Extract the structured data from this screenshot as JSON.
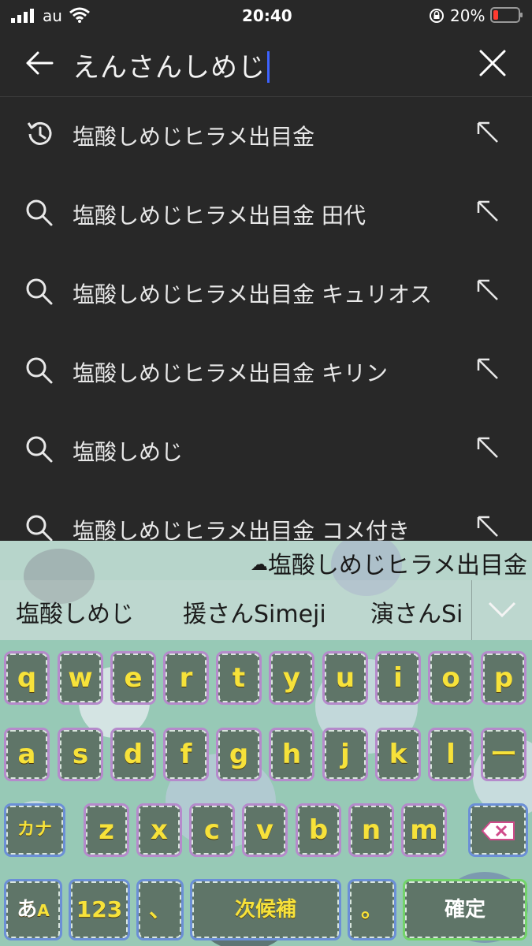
{
  "status_bar": {
    "carrier": "au",
    "time": "20:40",
    "battery_percent": "20%",
    "battery_level": 0.2
  },
  "search": {
    "query": "えんさんしめじ"
  },
  "suggestions": [
    {
      "type": "history",
      "text": "塩酸しめじヒラメ出目金"
    },
    {
      "type": "search",
      "text": "塩酸しめじヒラメ出目金 田代"
    },
    {
      "type": "search",
      "text": "塩酸しめじヒラメ出目金 キュリオス"
    },
    {
      "type": "search",
      "text": "塩酸しめじヒラメ出目金 キリン"
    },
    {
      "type": "search",
      "text": "塩酸しめじ"
    },
    {
      "type": "search",
      "text": "塩酸しめじヒラメ出目金 コメ付き"
    }
  ],
  "keyboard": {
    "cloud_candidate": "塩酸しめじヒラメ出目金",
    "candidates": [
      "塩酸しめじ",
      "援さんSimeji",
      "演さんSi"
    ],
    "row1": [
      "q",
      "w",
      "e",
      "r",
      "t",
      "y",
      "u",
      "i",
      "o",
      "p"
    ],
    "row2": [
      "a",
      "s",
      "d",
      "f",
      "g",
      "h",
      "j",
      "k",
      "l",
      "ー"
    ],
    "row3": [
      "z",
      "x",
      "c",
      "v",
      "b",
      "n",
      "m"
    ],
    "kana_key": "カナ",
    "mode_key_main": "あ",
    "mode_key_sub": "A",
    "num_key": "123",
    "comma_key": "、",
    "space_key": "次候補",
    "period_key": "。",
    "confirm_key": "確定"
  },
  "colors": {
    "background": "#282828",
    "caret": "#3d63ff",
    "keyboard_bg": "#97c9b6",
    "key_text": "#f7e23a",
    "key_fill": "#5f7568"
  }
}
